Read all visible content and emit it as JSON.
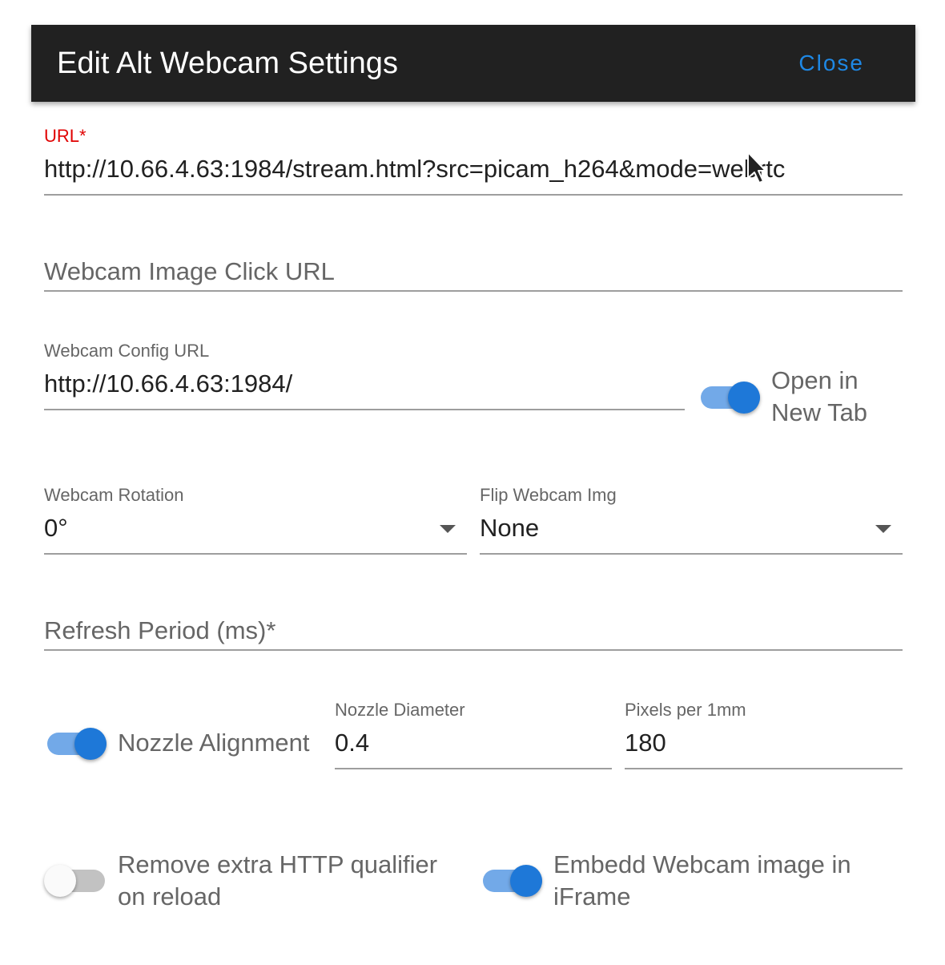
{
  "dialog": {
    "title": "Edit Alt Webcam Settings",
    "close_label": "Close"
  },
  "url_field": {
    "label": "URL*",
    "value": "http://10.66.4.63:1984/stream.html?src=picam_h264&mode=webrtc"
  },
  "click_url_field": {
    "placeholder": "Webcam Image Click URL"
  },
  "config_url_field": {
    "label": "Webcam Config URL",
    "value": "http://10.66.4.63:1984/"
  },
  "open_new_tab": {
    "label": "Open in New Tab",
    "checked": true
  },
  "rotation": {
    "label": "Webcam Rotation",
    "selected": "0°"
  },
  "flip": {
    "label": "Flip Webcam Img",
    "selected": "None"
  },
  "refresh_field": {
    "placeholder": "Refresh Period (ms)*"
  },
  "nozzle_alignment": {
    "label": "Nozzle Alignment",
    "checked": true
  },
  "nozzle_diameter": {
    "label": "Nozzle Diameter",
    "value": "0.4"
  },
  "pixels_per_mm": {
    "label": "Pixels per 1mm",
    "value": "180"
  },
  "remove_http_qualifier": {
    "label": "Remove extra HTTP qualifier on reload",
    "checked": false
  },
  "embed_iframe": {
    "label": "Embedd Webcam image in iFrame",
    "checked": true
  },
  "colors": {
    "accent": "#1e88e5",
    "header_bg": "#212121",
    "required_label": "#e00000"
  },
  "icons": {
    "dropdown": "caret-down-icon",
    "pointer": "mouse-cursor-icon"
  }
}
